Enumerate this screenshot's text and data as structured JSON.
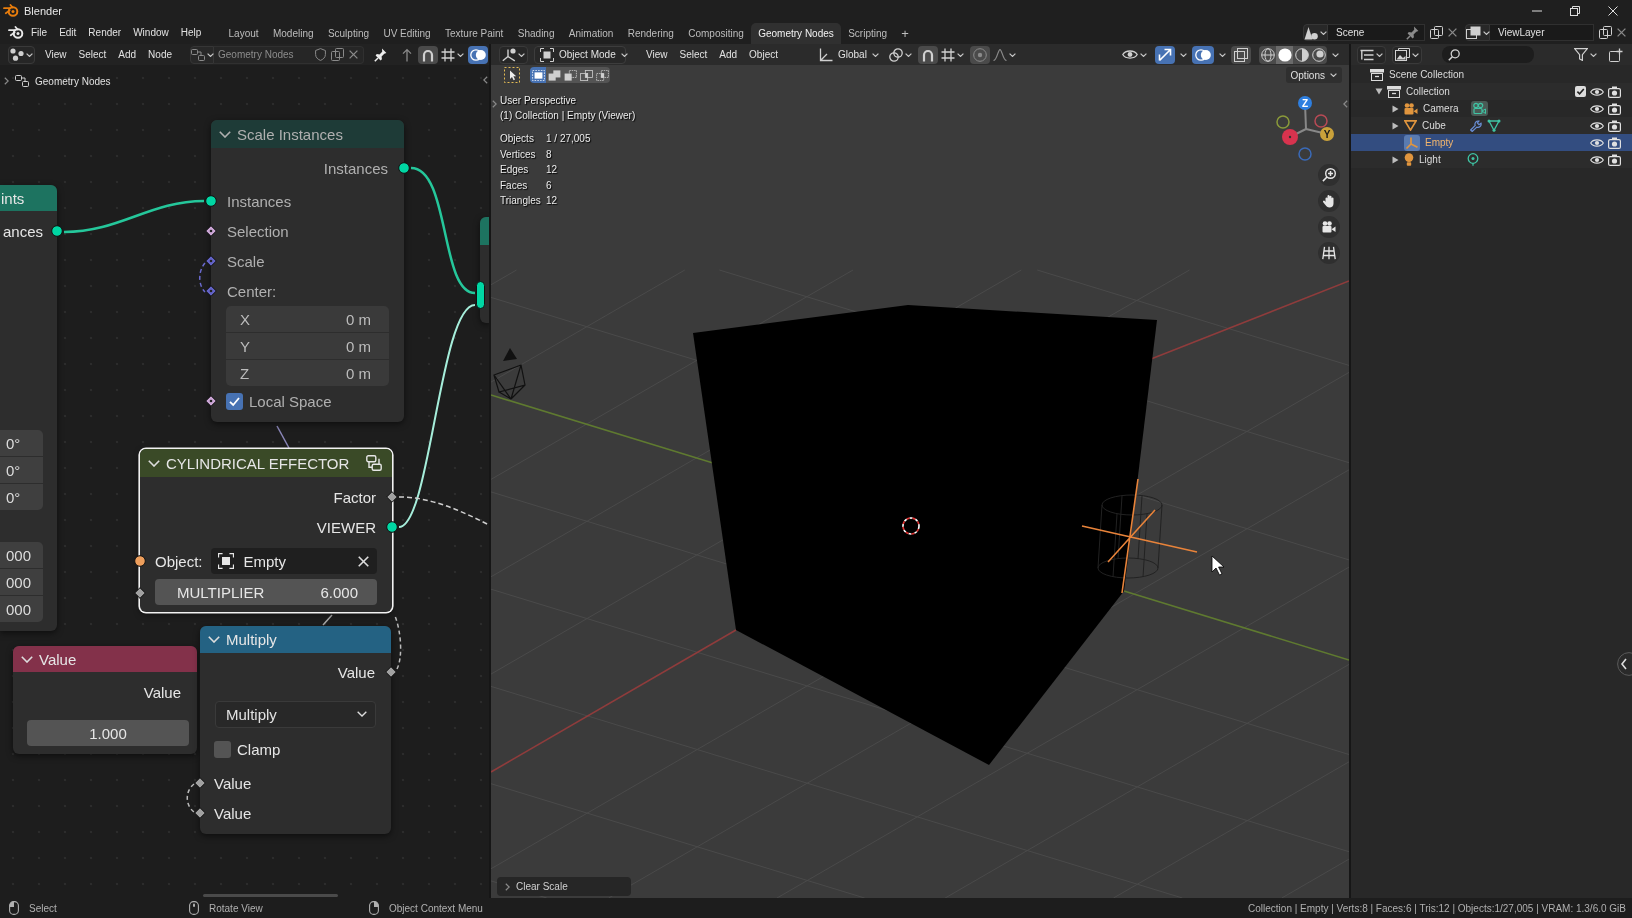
{
  "window": {
    "title": "Blender"
  },
  "topbar": {
    "menus": [
      "File",
      "Edit",
      "Render",
      "Window",
      "Help"
    ],
    "workspaces": [
      {
        "label": "Layout",
        "selected": false
      },
      {
        "label": "Modeling",
        "selected": false
      },
      {
        "label": "Sculpting",
        "selected": false
      },
      {
        "label": "UV Editing",
        "selected": false
      },
      {
        "label": "Texture Paint",
        "selected": false
      },
      {
        "label": "Shading",
        "selected": false
      },
      {
        "label": "Animation",
        "selected": false
      },
      {
        "label": "Rendering",
        "selected": false
      },
      {
        "label": "Compositing",
        "selected": false
      },
      {
        "label": "Geometry Nodes",
        "selected": true
      },
      {
        "label": "Scripting",
        "selected": false
      }
    ],
    "add_tab": "+",
    "scene": "Scene",
    "view_layer": "ViewLayer"
  },
  "node_editor": {
    "menus": [
      "View",
      "Select",
      "Add",
      "Node"
    ],
    "node_tree": "Geometry Nodes",
    "overlays_on": true,
    "breadcrumb": "Geometry Nodes",
    "nodes": [
      {
        "kind": "cut",
        "title": "ints",
        "color": "#1d7360",
        "selected": false,
        "dimmed": false,
        "rows": [
          {
            "kind": "output",
            "label": "ances",
            "socket": {
              "kind": "geometry"
            }
          },
          {
            "kind": "vector",
            "items": [
              {
                "value": "0°"
              },
              {
                "value": "0°"
              },
              {
                "value": "0°"
              }
            ]
          },
          {
            "kind": "vector",
            "items": [
              {
                "value": "000"
              },
              {
                "value": "000"
              },
              {
                "value": "000"
              }
            ]
          }
        ]
      },
      {
        "kind": "standard",
        "title": "Scale Instances",
        "color": "#1e3b37",
        "selected": false,
        "dimmed": true,
        "rows": [
          {
            "kind": "output",
            "label": "Instances",
            "socket": {
              "kind": "geometry"
            }
          },
          {
            "kind": "input",
            "label": "Instances",
            "socket": {
              "kind": "geometry"
            }
          },
          {
            "kind": "input",
            "label": "Selection",
            "socket": {
              "kind": "boolean"
            }
          },
          {
            "kind": "input",
            "label": "Scale",
            "socket": {
              "kind": "vector"
            }
          },
          {
            "kind": "input",
            "label": "Center:",
            "socket": {
              "kind": "vector"
            }
          },
          {
            "kind": "vector",
            "items": [
              {
                "axis": "X",
                "value": "0 m"
              },
              {
                "axis": "Y",
                "value": "0 m"
              },
              {
                "axis": "Z",
                "value": "0 m"
              }
            ]
          },
          {
            "kind": "checkbox",
            "label": "Local Space",
            "socket": {
              "kind": "boolean"
            },
            "checked": true
          }
        ]
      },
      {
        "kind": "group",
        "title": "CYLINDRICAL EFFECTOR",
        "color": "#3a4a27",
        "selected": true,
        "dimmed": false,
        "rows": [
          {
            "kind": "output",
            "label": "Factor",
            "socket": {
              "kind": "float"
            }
          },
          {
            "kind": "output",
            "label": "VIEWER",
            "socket": {
              "kind": "geometry"
            }
          },
          {
            "kind": "object",
            "label": "Object:",
            "value": "Empty",
            "socket": {
              "kind": "object"
            }
          },
          {
            "kind": "number",
            "label": "MULTIPLIER",
            "value": "6.000",
            "socket": {
              "kind": "float"
            }
          }
        ]
      },
      {
        "kind": "standard",
        "title": "Value",
        "color": "#83314a",
        "selected": false,
        "dimmed": false,
        "rows": [
          {
            "kind": "output",
            "label": "Value"
          },
          {
            "kind": "number",
            "value": "1.000"
          }
        ]
      },
      {
        "kind": "standard",
        "title": "Multiply",
        "color": "#246283",
        "selected": false,
        "dimmed": false,
        "rows": [
          {
            "kind": "output",
            "label": "Value",
            "socket": {
              "kind": "float"
            }
          },
          {
            "kind": "dropdown",
            "value": "Multiply"
          },
          {
            "kind": "checkbox",
            "label": "Clamp",
            "checked": false
          },
          {
            "kind": "input",
            "label": "Value",
            "socket": {
              "kind": "float"
            }
          },
          {
            "kind": "input",
            "label": "Value",
            "socket": {
              "kind": "float"
            }
          }
        ]
      },
      {
        "kind": "cut",
        "color": "#1d7360",
        "rows": [
          {
            "kind": "input",
            "socket": {
              "kind": "multi"
            }
          }
        ]
      }
    ]
  },
  "viewport": {
    "mode": "Object Mode",
    "menus": [
      "View",
      "Select",
      "Add",
      "Object"
    ],
    "orientation": "Global",
    "select_modes": [
      {
        "kind": "set",
        "selected": true
      },
      {
        "kind": "extend",
        "selected": false
      },
      {
        "kind": "subtract",
        "selected": false
      },
      {
        "kind": "difference",
        "selected": false
      },
      {
        "kind": "intersect",
        "selected": false
      }
    ],
    "toggles": [
      {
        "kind": "gizmos",
        "on": true
      },
      {
        "kind": "overlays",
        "on": true
      },
      {
        "kind": "xray",
        "on": false
      }
    ],
    "shading": [
      {
        "kind": "wireframe",
        "selected": false
      },
      {
        "kind": "solid",
        "selected": true
      },
      {
        "kind": "material",
        "selected": false
      },
      {
        "kind": "rendered",
        "selected": false
      }
    ],
    "options": "Options",
    "info": [
      "User Perspective",
      "(1) Collection | Empty (Viewer)"
    ],
    "stats": [
      {
        "label": "Objects",
        "value": "1 / 27,005"
      },
      {
        "label": "Vertices",
        "value": "8"
      },
      {
        "label": "Edges",
        "value": "12"
      },
      {
        "label": "Faces",
        "value": "6"
      },
      {
        "label": "Triangles",
        "value": "12"
      }
    ],
    "gizmo": [
      {
        "kind": "z",
        "label": "Z"
      },
      {
        "kind": "y",
        "label": "Y"
      }
    ],
    "last_operator": "Clear Scale"
  },
  "outliner": {
    "tree": [
      {
        "kind": "scene",
        "label": "Scene Collection",
        "children": [
          {
            "kind": "collection",
            "label": "Collection",
            "expanded": true,
            "included": true,
            "visible": true,
            "selected": false,
            "children": [
              {
                "kind": "camera",
                "label": "Camera",
                "expanded": false,
                "visible": true,
                "selected": false,
                "data": [
                  {
                    "kind": "camera"
                  }
                ]
              },
              {
                "kind": "mesh",
                "label": "Cube",
                "expanded": false,
                "visible": true,
                "selected": false,
                "data": [
                  {
                    "kind": "modifier"
                  },
                  {
                    "kind": "mesh"
                  }
                ]
              },
              {
                "kind": "empty",
                "label": "Empty",
                "visible": true,
                "selected": true
              },
              {
                "kind": "light",
                "label": "Light",
                "expanded": false,
                "visible": true,
                "selected": false,
                "data": [
                  {
                    "kind": "light"
                  }
                ]
              }
            ]
          }
        ]
      }
    ]
  },
  "status_bar": {
    "hints": [
      {
        "kind": "left",
        "label": "Select"
      },
      {
        "kind": "middle",
        "label": "Rotate View"
      },
      {
        "kind": "right",
        "label": "Object Context Menu"
      }
    ],
    "info": "Collection | Empty | Verts:8 | Faces:6 | Tris:12 | Objects:1/27,005 | VRAM: 1.3/6.0 GiB"
  }
}
